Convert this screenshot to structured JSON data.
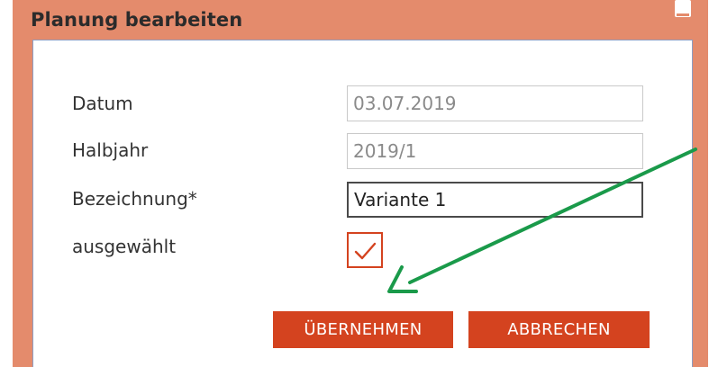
{
  "dialog": {
    "title": "Planung bearbeiten",
    "minimize_icon": "minimize-icon",
    "colors": {
      "frame": "#e48b6c",
      "accent": "#d4431f",
      "annotation_arrow": "#1a9a4a"
    }
  },
  "form": {
    "datum": {
      "label": "Datum",
      "value": "03.07.2019"
    },
    "halbjahr": {
      "label": "Halbjahr",
      "value": "2019/1"
    },
    "bezeichnung": {
      "label": "Bezeichnung*",
      "value": "Variante 1"
    },
    "ausgewaehlt": {
      "label": "ausgewählt",
      "checked": true,
      "icon": "checkmark-icon"
    }
  },
  "buttons": {
    "ok_label": "ÜBERNEHMEN",
    "cancel_label": "ABBRECHEN"
  },
  "annotation": {
    "icon": "arrow-icon"
  }
}
